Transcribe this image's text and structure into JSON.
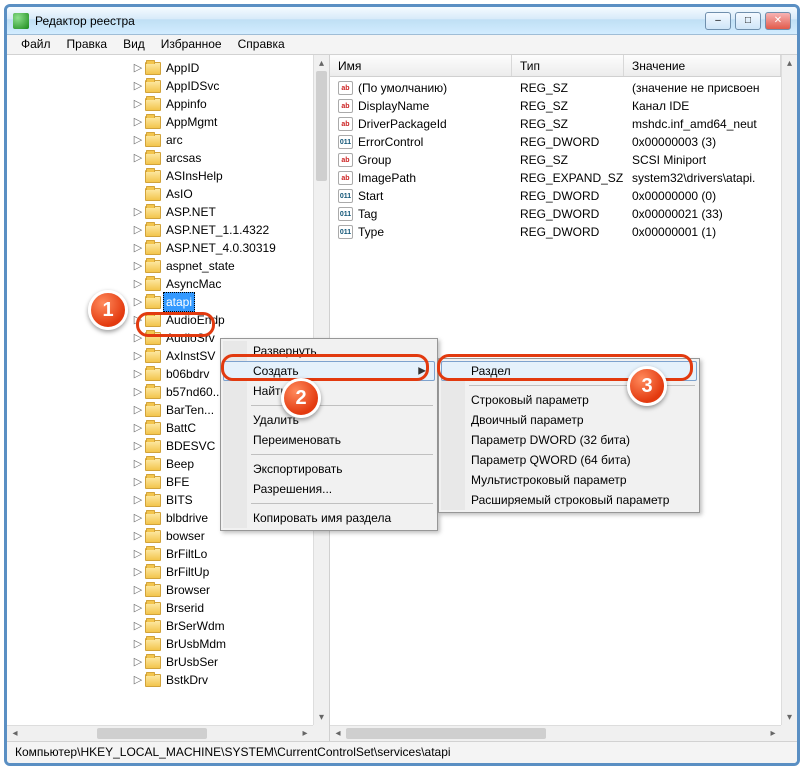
{
  "window": {
    "title": "Редактор реестра",
    "min_label": "–",
    "max_label": "□",
    "close_label": "✕"
  },
  "menu": {
    "file": "Файл",
    "edit": "Правка",
    "view": "Вид",
    "favorites": "Избранное",
    "help": "Справка"
  },
  "tree": {
    "items": [
      {
        "label": "AppID",
        "expander": "▷"
      },
      {
        "label": "AppIDSvc",
        "expander": "▷"
      },
      {
        "label": "Appinfo",
        "expander": "▷"
      },
      {
        "label": "AppMgmt",
        "expander": "▷"
      },
      {
        "label": "arc",
        "expander": "▷"
      },
      {
        "label": "arcsas",
        "expander": "▷"
      },
      {
        "label": "ASInsHelp",
        "expander": " "
      },
      {
        "label": "AsIO",
        "expander": " "
      },
      {
        "label": "ASP.NET",
        "expander": "▷"
      },
      {
        "label": "ASP.NET_1.1.4322",
        "expander": "▷"
      },
      {
        "label": "ASP.NET_4.0.30319",
        "expander": "▷"
      },
      {
        "label": "aspnet_state",
        "expander": "▷"
      },
      {
        "label": "AsyncMac",
        "expander": "▷"
      },
      {
        "label": "atapi",
        "expander": "▷",
        "selected": true
      },
      {
        "label": "AudioEndp",
        "expander": "▷"
      },
      {
        "label": "AudioSrv",
        "expander": "▷"
      },
      {
        "label": "AxInstSV",
        "expander": "▷"
      },
      {
        "label": "b06bdrv",
        "expander": "▷"
      },
      {
        "label": "b57nd60...",
        "expander": "▷"
      },
      {
        "label": "BarTen...",
        "expander": "▷"
      },
      {
        "label": "BattC",
        "expander": "▷"
      },
      {
        "label": "BDESVC",
        "expander": "▷"
      },
      {
        "label": "Beep",
        "expander": "▷"
      },
      {
        "label": "BFE",
        "expander": "▷"
      },
      {
        "label": "BITS",
        "expander": "▷"
      },
      {
        "label": "blbdrive",
        "expander": "▷"
      },
      {
        "label": "bowser",
        "expander": "▷"
      },
      {
        "label": "BrFiltLo",
        "expander": "▷"
      },
      {
        "label": "BrFiltUp",
        "expander": "▷"
      },
      {
        "label": "Browser",
        "expander": "▷"
      },
      {
        "label": "Brserid",
        "expander": "▷"
      },
      {
        "label": "BrSerWdm",
        "expander": "▷"
      },
      {
        "label": "BrUsbMdm",
        "expander": "▷"
      },
      {
        "label": "BrUsbSer",
        "expander": "▷"
      },
      {
        "label": "BstkDrv",
        "expander": "▷"
      }
    ]
  },
  "list": {
    "headers": {
      "name": "Имя",
      "type": "Тип",
      "value": "Значение"
    },
    "rows": [
      {
        "icon": "str",
        "name": "(По умолчанию)",
        "type": "REG_SZ",
        "value": "(значение не присвоен"
      },
      {
        "icon": "str",
        "name": "DisplayName",
        "type": "REG_SZ",
        "value": "Канал IDE"
      },
      {
        "icon": "str",
        "name": "DriverPackageId",
        "type": "REG_SZ",
        "value": "mshdc.inf_amd64_neut"
      },
      {
        "icon": "bin",
        "name": "ErrorControl",
        "type": "REG_DWORD",
        "value": "0x00000003 (3)"
      },
      {
        "icon": "str",
        "name": "Group",
        "type": "REG_SZ",
        "value": "SCSI Miniport"
      },
      {
        "icon": "str",
        "name": "ImagePath",
        "type": "REG_EXPAND_SZ",
        "value": "system32\\drivers\\atapi."
      },
      {
        "icon": "bin",
        "name": "Start",
        "type": "REG_DWORD",
        "value": "0x00000000 (0)"
      },
      {
        "icon": "bin",
        "name": "Tag",
        "type": "REG_DWORD",
        "value": "0x00000021 (33)"
      },
      {
        "icon": "bin",
        "name": "Type",
        "type": "REG_DWORD",
        "value": "0x00000001 (1)"
      }
    ]
  },
  "context1": {
    "expand": "Развернуть",
    "create": "Создать",
    "find": "Найти...",
    "delete": "Удалить",
    "rename": "Переименовать",
    "export": "Экспортировать",
    "permissions": "Разрешения...",
    "copy_key": "Копировать имя раздела"
  },
  "context2": {
    "key": "Раздел",
    "string": "Строковый параметр",
    "binary": "Двоичный параметр",
    "dword": "Параметр DWORD (32 бита)",
    "qword": "Параметр QWORD (64 бита)",
    "multi": "Мультистроковый параметр",
    "expand": "Расширяемый строковый параметр"
  },
  "status": {
    "path": "Компьютер\\HKEY_LOCAL_MACHINE\\SYSTEM\\CurrentControlSet\\services\\atapi"
  },
  "badges": {
    "b1": "1",
    "b2": "2",
    "b3": "3"
  },
  "icon_text": {
    "str": "ab",
    "bin": "011"
  }
}
